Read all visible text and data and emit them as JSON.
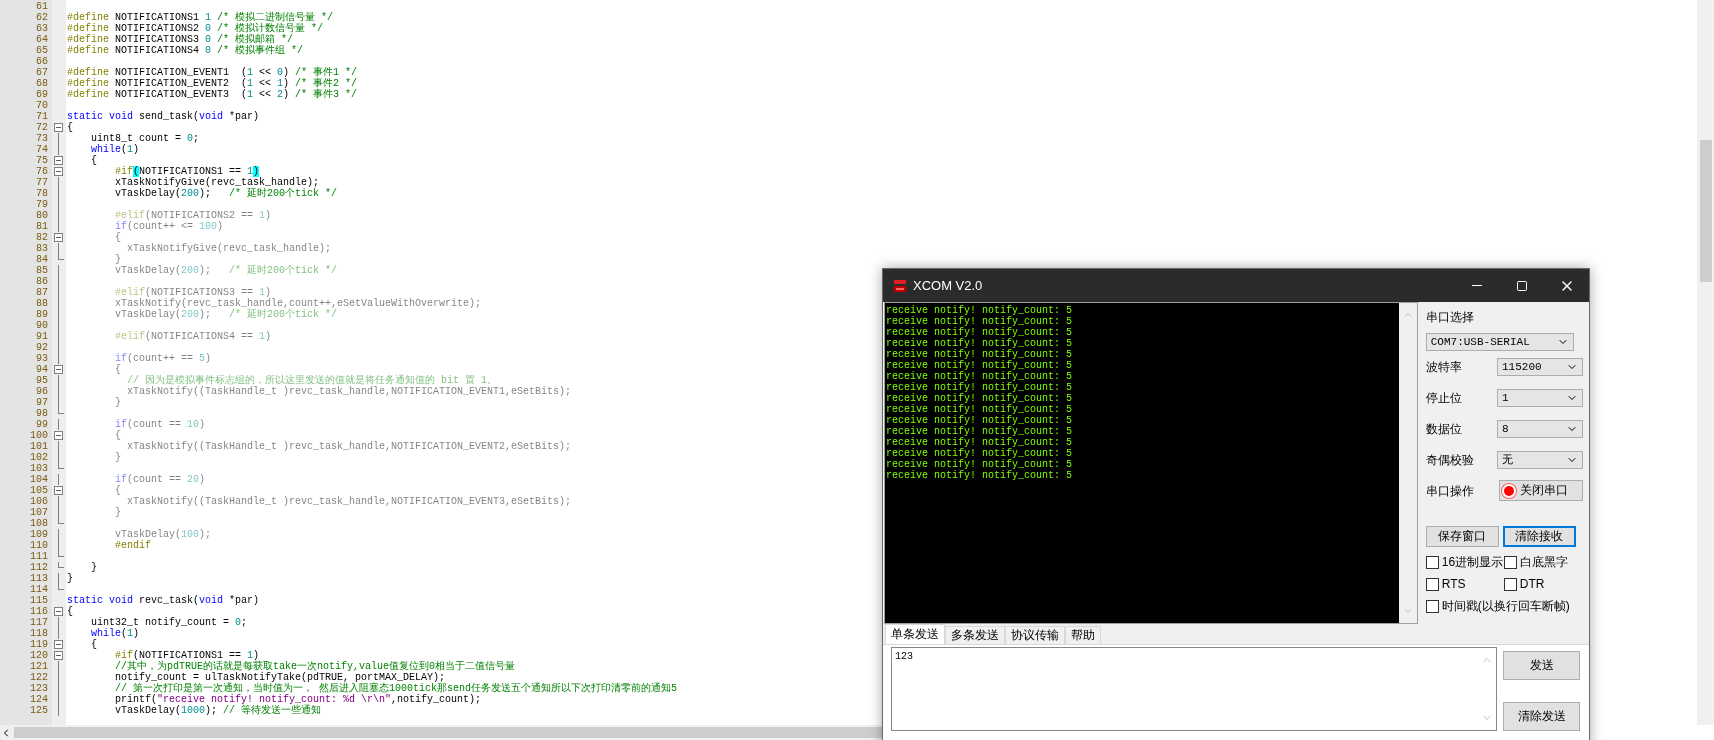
{
  "editor": {
    "lines": [
      {
        "number": "61",
        "kind": "plain"
      },
      {
        "number": "62",
        "kind": "plain",
        "inactive": false,
        "tokens": [
          {
            "kind": "pp",
            "text": "#define"
          },
          {
            "kind": "tx",
            "text": " NOTIFICATIONS1 "
          },
          {
            "kind": "num",
            "text": "1"
          },
          {
            "kind": "cm",
            "text": " /* 模拟二进制信号量 */"
          }
        ]
      },
      {
        "number": "63",
        "kind": "plain",
        "inactive": false,
        "tokens": [
          {
            "kind": "pp",
            "text": "#define"
          },
          {
            "kind": "tx",
            "text": " NOTIFICATIONS2 "
          },
          {
            "kind": "num",
            "text": "0"
          },
          {
            "kind": "cm",
            "text": " /* 模拟计数信号量 */"
          }
        ]
      },
      {
        "number": "64",
        "kind": "plain",
        "inactive": false,
        "tokens": [
          {
            "kind": "pp",
            "text": "#define"
          },
          {
            "kind": "tx",
            "text": " NOTIFICATIONS3 "
          },
          {
            "kind": "num",
            "text": "0"
          },
          {
            "kind": "cm",
            "text": " /* 模拟邮箱 */"
          }
        ]
      },
      {
        "number": "65",
        "kind": "plain",
        "inactive": false,
        "tokens": [
          {
            "kind": "pp",
            "text": "#define"
          },
          {
            "kind": "tx",
            "text": " NOTIFICATIONS4 "
          },
          {
            "kind": "num",
            "text": "0"
          },
          {
            "kind": "cm",
            "text": " /* 模拟事件组 */"
          }
        ]
      },
      {
        "number": "66",
        "kind": "plain"
      },
      {
        "number": "67",
        "kind": "plain",
        "inactive": false,
        "tokens": [
          {
            "kind": "pp",
            "text": "#define"
          },
          {
            "kind": "tx",
            "text": " NOTIFICATION_EVENT1  ("
          },
          {
            "kind": "num",
            "text": "1"
          },
          {
            "kind": "tx",
            "text": " << "
          },
          {
            "kind": "num",
            "text": "0"
          },
          {
            "kind": "tx",
            "text": ")"
          },
          {
            "kind": "cm",
            "text": " /* 事件1 */"
          }
        ]
      },
      {
        "number": "68",
        "kind": "plain",
        "inactive": false,
        "tokens": [
          {
            "kind": "pp",
            "text": "#define"
          },
          {
            "kind": "tx",
            "text": " NOTIFICATION_EVENT2  ("
          },
          {
            "kind": "num",
            "text": "1"
          },
          {
            "kind": "tx",
            "text": " << "
          },
          {
            "kind": "num",
            "text": "1"
          },
          {
            "kind": "tx",
            "text": ")"
          },
          {
            "kind": "cm",
            "text": " /* 事件2 */"
          }
        ]
      },
      {
        "number": "69",
        "kind": "plain",
        "inactive": false,
        "tokens": [
          {
            "kind": "pp",
            "text": "#define"
          },
          {
            "kind": "tx",
            "text": " NOTIFICATION_EVENT3  ("
          },
          {
            "kind": "num",
            "text": "1"
          },
          {
            "kind": "tx",
            "text": " << "
          },
          {
            "kind": "num",
            "text": "2"
          },
          {
            "kind": "tx",
            "text": ")"
          },
          {
            "kind": "cm",
            "text": " /* 事件3 */"
          }
        ]
      },
      {
        "number": "70",
        "kind": "plain"
      },
      {
        "number": "71",
        "kind": "plain",
        "inactive": false,
        "tokens": [
          {
            "kind": "kw",
            "text": "static void"
          },
          {
            "kind": "tx",
            "text": " send_task("
          },
          {
            "kind": "kw",
            "text": "void"
          },
          {
            "kind": "tx",
            "text": " *par)"
          }
        ]
      },
      {
        "number": "72",
        "kind": "open",
        "inactive": false,
        "tokens": [
          {
            "kind": "tx",
            "text": "{"
          }
        ]
      },
      {
        "number": "73",
        "kind": "line",
        "inactive": false,
        "tokens": [
          {
            "kind": "tx",
            "text": "    uint8_t count = "
          },
          {
            "kind": "num",
            "text": "0"
          },
          {
            "kind": "tx",
            "text": ";"
          }
        ]
      },
      {
        "number": "74",
        "kind": "line",
        "inactive": false,
        "tokens": [
          {
            "kind": "kw",
            "text": "    while"
          },
          {
            "kind": "tx",
            "text": "("
          },
          {
            "kind": "num",
            "text": "1"
          },
          {
            "kind": "tx",
            "text": ")"
          }
        ]
      },
      {
        "number": "75",
        "kind": "open",
        "inactive": false,
        "tokens": [
          {
            "kind": "tx",
            "text": "    {"
          }
        ]
      },
      {
        "number": "76",
        "kind": "open",
        "inactive": false,
        "tokens": [
          {
            "kind": "pp",
            "text": "        #if"
          },
          {
            "kind": "match",
            "text": "("
          },
          {
            "kind": "tx",
            "text": "NOTIFICATIONS1 == "
          },
          {
            "kind": "num",
            "text": "1"
          },
          {
            "kind": "match",
            "text": ")"
          }
        ]
      },
      {
        "number": "77",
        "kind": "line",
        "inactive": false,
        "tokens": [
          {
            "kind": "tx",
            "text": "        xTaskNotifyGive(revc_task_handle);"
          }
        ]
      },
      {
        "number": "78",
        "kind": "line",
        "inactive": false,
        "tokens": [
          {
            "kind": "tx",
            "text": "        vTaskDelay("
          },
          {
            "kind": "num",
            "text": "200"
          },
          {
            "kind": "tx",
            "text": ");   "
          },
          {
            "kind": "cm",
            "text": "/* 延时200个tick */"
          }
        ]
      },
      {
        "number": "79",
        "kind": "line"
      },
      {
        "number": "80",
        "kind": "line",
        "inactive": true,
        "tokens": [
          {
            "kind": "pp",
            "text": "        #elif"
          },
          {
            "kind": "tx",
            "text": "(NOTIFICATIONS2 == "
          },
          {
            "kind": "num",
            "text": "1"
          },
          {
            "kind": "tx",
            "text": ")"
          }
        ]
      },
      {
        "number": "81",
        "kind": "line",
        "inactive": true,
        "tokens": [
          {
            "kind": "kw",
            "text": "        if"
          },
          {
            "kind": "tx",
            "text": "(count++ <= "
          },
          {
            "kind": "num",
            "text": "100"
          },
          {
            "kind": "tx",
            "text": ")"
          }
        ]
      },
      {
        "number": "82",
        "kind": "open",
        "inactive": true,
        "tokens": [
          {
            "kind": "tx",
            "text": "        {"
          }
        ]
      },
      {
        "number": "83",
        "kind": "line",
        "inactive": true,
        "tokens": [
          {
            "kind": "tx",
            "text": "          xTaskNotifyGive(revc_task_handle);"
          }
        ]
      },
      {
        "number": "84",
        "kind": "end",
        "inactive": true,
        "tokens": [
          {
            "kind": "tx",
            "text": "        }"
          }
        ]
      },
      {
        "number": "85",
        "kind": "line",
        "inactive": true,
        "tokens": [
          {
            "kind": "tx",
            "text": "        vTaskDelay("
          },
          {
            "kind": "num",
            "text": "200"
          },
          {
            "kind": "tx",
            "text": ");   "
          },
          {
            "kind": "cm",
            "text": "/* 延时200个tick */"
          }
        ]
      },
      {
        "number": "86",
        "kind": "line"
      },
      {
        "number": "87",
        "kind": "line",
        "inactive": true,
        "tokens": [
          {
            "kind": "pp",
            "text": "        #elif"
          },
          {
            "kind": "tx",
            "text": "(NOTIFICATIONS3 == "
          },
          {
            "kind": "num",
            "text": "1"
          },
          {
            "kind": "tx",
            "text": ")"
          }
        ]
      },
      {
        "number": "88",
        "kind": "line",
        "inactive": true,
        "tokens": [
          {
            "kind": "tx",
            "text": "        xTaskNotify(revc_task_handle,count++,eSetValueWithOverwrite);"
          }
        ]
      },
      {
        "number": "89",
        "kind": "line",
        "inactive": true,
        "tokens": [
          {
            "kind": "tx",
            "text": "        vTaskDelay("
          },
          {
            "kind": "num",
            "text": "200"
          },
          {
            "kind": "tx",
            "text": ");   "
          },
          {
            "kind": "cm",
            "text": "/* 延时200个tick */"
          }
        ]
      },
      {
        "number": "90",
        "kind": "line"
      },
      {
        "number": "91",
        "kind": "line",
        "inactive": true,
        "tokens": [
          {
            "kind": "pp",
            "text": "        #elif"
          },
          {
            "kind": "tx",
            "text": "(NOTIFICATIONS4 == "
          },
          {
            "kind": "num",
            "text": "1"
          },
          {
            "kind": "tx",
            "text": ")"
          }
        ]
      },
      {
        "number": "92",
        "kind": "line"
      },
      {
        "number": "93",
        "kind": "line",
        "inactive": true,
        "tokens": [
          {
            "kind": "kw",
            "text": "        if"
          },
          {
            "kind": "tx",
            "text": "(count++ == "
          },
          {
            "kind": "num",
            "text": "5"
          },
          {
            "kind": "tx",
            "text": ")"
          }
        ]
      },
      {
        "number": "94",
        "kind": "open",
        "inactive": true,
        "tokens": [
          {
            "kind": "tx",
            "text": "        {"
          }
        ]
      },
      {
        "number": "95",
        "kind": "line",
        "inactive": true,
        "tokens": [
          {
            "kind": "cm",
            "text": "          // 因为是模拟事件标志组的，所以这里发送的值就是将任务通知值的 bit 置 1。"
          }
        ]
      },
      {
        "number": "96",
        "kind": "line",
        "inactive": true,
        "tokens": [
          {
            "kind": "tx",
            "text": "          xTaskNotify((TaskHandle_t )revc_task_handle,NOTIFICATION_EVENT1,eSetBits);"
          }
        ]
      },
      {
        "number": "97",
        "kind": "line",
        "inactive": true,
        "tokens": [
          {
            "kind": "tx",
            "text": "        }"
          }
        ]
      },
      {
        "number": "98",
        "kind": "end"
      },
      {
        "number": "99",
        "kind": "line",
        "inactive": true,
        "tokens": [
          {
            "kind": "kw",
            "text": "        if"
          },
          {
            "kind": "tx",
            "text": "(count == "
          },
          {
            "kind": "num",
            "text": "10"
          },
          {
            "kind": "tx",
            "text": ")"
          }
        ]
      },
      {
        "number": "100",
        "kind": "open",
        "inactive": true,
        "tokens": [
          {
            "kind": "tx",
            "text": "        {"
          }
        ]
      },
      {
        "number": "101",
        "kind": "line",
        "inactive": true,
        "tokens": [
          {
            "kind": "tx",
            "text": "          xTaskNotify((TaskHandle_t )revc_task_handle,NOTIFICATION_EVENT2,eSetBits);"
          }
        ]
      },
      {
        "number": "102",
        "kind": "line",
        "inactive": true,
        "tokens": [
          {
            "kind": "tx",
            "text": "        }"
          }
        ]
      },
      {
        "number": "103",
        "kind": "end"
      },
      {
        "number": "104",
        "kind": "line",
        "inactive": true,
        "tokens": [
          {
            "kind": "kw",
            "text": "        if"
          },
          {
            "kind": "tx",
            "text": "(count == "
          },
          {
            "kind": "num",
            "text": "20"
          },
          {
            "kind": "tx",
            "text": ")"
          }
        ]
      },
      {
        "number": "105",
        "kind": "open",
        "inactive": true,
        "tokens": [
          {
            "kind": "tx",
            "text": "        {"
          }
        ]
      },
      {
        "number": "106",
        "kind": "line",
        "inactive": true,
        "tokens": [
          {
            "kind": "tx",
            "text": "          xTaskNotify((TaskHandle_t )revc_task_handle,NOTIFICATION_EVENT3,eSetBits);"
          }
        ]
      },
      {
        "number": "107",
        "kind": "line",
        "inactive": true,
        "tokens": [
          {
            "kind": "tx",
            "text": "        }"
          }
        ]
      },
      {
        "number": "108",
        "kind": "end"
      },
      {
        "number": "109",
        "kind": "line",
        "inactive": true,
        "tokens": [
          {
            "kind": "tx",
            "text": "        vTaskDelay("
          },
          {
            "kind": "num",
            "text": "100"
          },
          {
            "kind": "tx",
            "text": ");"
          }
        ]
      },
      {
        "number": "110",
        "kind": "line",
        "inactive": false,
        "tokens": [
          {
            "kind": "pp",
            "text": "        #endif"
          }
        ]
      },
      {
        "number": "111",
        "kind": "end"
      },
      {
        "number": "112",
        "kind": "end",
        "inactive": false,
        "tokens": [
          {
            "kind": "tx",
            "text": "    }"
          }
        ]
      },
      {
        "number": "113",
        "kind": "line",
        "inactive": false,
        "tokens": [
          {
            "kind": "tx",
            "text": "}"
          }
        ]
      },
      {
        "number": "114",
        "kind": "end"
      },
      {
        "number": "115",
        "kind": "plain",
        "inactive": false,
        "tokens": [
          {
            "kind": "kw",
            "text": "static void"
          },
          {
            "kind": "tx",
            "text": " revc_task("
          },
          {
            "kind": "kw",
            "text": "void"
          },
          {
            "kind": "tx",
            "text": " *par)"
          }
        ]
      },
      {
        "number": "116",
        "kind": "open",
        "inactive": false,
        "tokens": [
          {
            "kind": "tx",
            "text": "{"
          }
        ]
      },
      {
        "number": "117",
        "kind": "line",
        "inactive": false,
        "tokens": [
          {
            "kind": "tx",
            "text": "    uint32_t notify_count = "
          },
          {
            "kind": "num",
            "text": "0"
          },
          {
            "kind": "tx",
            "text": ";"
          }
        ]
      },
      {
        "number": "118",
        "kind": "line",
        "inactive": false,
        "tokens": [
          {
            "kind": "kw",
            "text": "    while"
          },
          {
            "kind": "tx",
            "text": "("
          },
          {
            "kind": "num",
            "text": "1"
          },
          {
            "kind": "tx",
            "text": ")"
          }
        ]
      },
      {
        "number": "119",
        "kind": "open",
        "inactive": false,
        "tokens": [
          {
            "kind": "tx",
            "text": "    {"
          }
        ]
      },
      {
        "number": "120",
        "kind": "open",
        "inactive": false,
        "tokens": [
          {
            "kind": "pp",
            "text": "        #if"
          },
          {
            "kind": "tx",
            "text": "(NOTIFICATIONS1 == "
          },
          {
            "kind": "num",
            "text": "1"
          },
          {
            "kind": "tx",
            "text": ")"
          }
        ]
      },
      {
        "number": "121",
        "kind": "line",
        "inactive": false,
        "tokens": [
          {
            "kind": "cm",
            "text": "        //其中，为pdTRUE的话就是每获取take一次notify,value值复位到0相当于二值信号量"
          }
        ]
      },
      {
        "number": "122",
        "kind": "line",
        "inactive": false,
        "tokens": [
          {
            "kind": "tx",
            "text": "        notify_count = ulTaskNotifyTake(pdTRUE, portMAX_DELAY);"
          }
        ]
      },
      {
        "number": "123",
        "kind": "line",
        "inactive": false,
        "tokens": [
          {
            "kind": "cm",
            "text": "        // 第一次打印是第一次通知，当时值为一， 然后进入阻塞态1000tick那send任务发送五个通知所以下次打印清零前的通知5"
          }
        ]
      },
      {
        "number": "124",
        "kind": "line",
        "inactive": false,
        "tokens": [
          {
            "kind": "tx",
            "text": "        printf("
          },
          {
            "kind": "str",
            "text": "\"receive notify! notify_count: %d \\r\\n\""
          },
          {
            "kind": "tx",
            "text": ",notify_count);"
          }
        ]
      },
      {
        "number": "125",
        "kind": "line",
        "inactive": false,
        "tokens": [
          {
            "kind": "tx",
            "text": "        vTaskDelay("
          },
          {
            "kind": "num",
            "text": "1000"
          },
          {
            "kind": "tx",
            "text": "); "
          },
          {
            "kind": "cm",
            "text": "// 等待发送一些通知"
          }
        ]
      }
    ]
  },
  "xcom": {
    "title": "XCOM V2.0",
    "receive_lines": [
      "receive notify! notify_count: 5",
      "receive notify! notify_count: 5",
      "receive notify! notify_count: 5",
      "receive notify! notify_count: 5",
      "receive notify! notify_count: 5",
      "receive notify! notify_count: 5",
      "receive notify! notify_count: 5",
      "receive notify! notify_count: 5",
      "receive notify! notify_count: 5",
      "receive notify! notify_count: 5",
      "receive notify! notify_count: 5",
      "receive notify! notify_count: 5",
      "receive notify! notify_count: 5",
      "receive notify! notify_count: 5",
      "receive notify! notify_count: 5",
      "receive notify! notify_count: 5"
    ],
    "port_label": "串口选择",
    "port_value": "COM7:USB-SERIAL",
    "settings": [
      {
        "label": "波特率",
        "value": "115200"
      },
      {
        "label": "停止位",
        "value": "1"
      },
      {
        "label": "数据位",
        "value": "8"
      },
      {
        "label": "奇偶校验",
        "value": "无"
      }
    ],
    "port_action": {
      "label": "串口操作",
      "button": "关闭串口",
      "open": true
    },
    "buttons": [
      {
        "label": "保存窗口",
        "focused": false
      },
      {
        "label": "清除接收",
        "focused": true
      }
    ],
    "checkbox_rows": [
      [
        {
          "label": "16进制显示",
          "checked": false
        },
        {
          "label": "白底黑字",
          "checked": false
        }
      ],
      [
        {
          "label": "RTS",
          "checked": false
        },
        {
          "label": "DTR",
          "checked": false
        }
      ],
      [
        {
          "label": "时间戳(以换行回车断帧)",
          "checked": false
        }
      ]
    ],
    "tabs": [
      {
        "label": "单条发送",
        "selected": true
      },
      {
        "label": "多条发送",
        "selected": false
      },
      {
        "label": "协议传输",
        "selected": false
      },
      {
        "label": "帮助",
        "selected": false
      }
    ],
    "send_text": "123",
    "send_buttons": [
      "发送",
      "清除发送"
    ]
  }
}
